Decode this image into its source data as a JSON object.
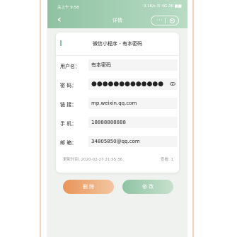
{
  "status": {
    "carrier": "关上午 9:58",
    "right": "0.1K/s ☰ 4G 26 ■■"
  },
  "navbar": {
    "back_icon": "chevron-left-icon",
    "title": "详情",
    "menu_icon": "more-dots-icon",
    "close_icon": "target-circle-icon"
  },
  "card": {
    "title": "微信小程序 - 有本密码",
    "fields": [
      {
        "label": "用户名：",
        "value": "有本密码"
      },
      {
        "label": "密 码：",
        "value": "●●●●●●●●●●●●●"
      },
      {
        "label": "链 接：",
        "value": "mp.weixin.qq.com"
      },
      {
        "label": "手 机：",
        "value": "18888888888"
      },
      {
        "label": "邮 箱：",
        "value": "34805850@qq.com"
      }
    ],
    "updated": "更新时间: 2020-02-27 21:55:36",
    "views": "查看: 1"
  },
  "buttons": {
    "delete": "删 除",
    "edit": "修 改"
  },
  "colors": {
    "accent": "#8fc2a2",
    "danger": "#e8955a"
  }
}
